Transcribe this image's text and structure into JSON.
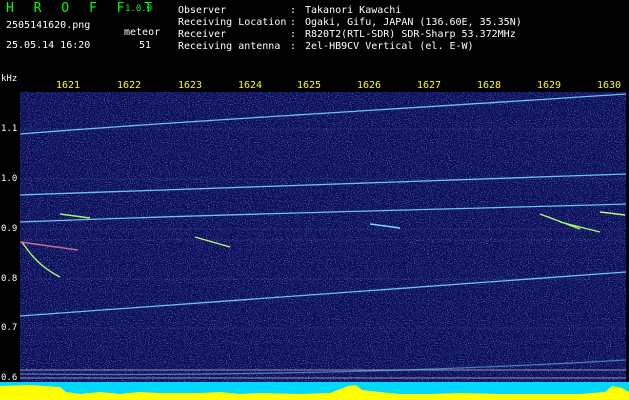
{
  "app": {
    "name": "H R O F F T",
    "version": "1.0.0"
  },
  "capture": {
    "filename": "2505141620.png",
    "datetime": "25.05.14 16:20"
  },
  "meteor": {
    "label": "meteor",
    "count": "51"
  },
  "info": [
    {
      "label": "Observer",
      "value": "Takanori Kawachi"
    },
    {
      "label": "Receiving Location",
      "value": "Ogaki, Gifu, JAPAN (136.60E, 35.35N)"
    },
    {
      "label": "Receiver",
      "value": "R820T2(RTL-SDR) SDR-Sharp 53.372MHz"
    },
    {
      "label": "Receiving antenna",
      "value": "2el-HB9CV Vertical (el. E-W)"
    }
  ],
  "axis": {
    "y_unit": "kHz",
    "x_ticks": [
      "1621",
      "1622",
      "1623",
      "1624",
      "1625",
      "1626",
      "1627",
      "1628",
      "1629",
      "1630"
    ],
    "y_ticks": [
      "1.1",
      "1.0",
      "0.9",
      "0.8",
      "0.7",
      "0.6"
    ]
  },
  "colors": {
    "background": "#0a0d55",
    "trace": "#7fe0ff",
    "header_green": "#00ff00",
    "tick_yellow": "#ffff00",
    "bottom_band": "#00d8ff",
    "bottom_peaks": "#ffff00"
  }
}
